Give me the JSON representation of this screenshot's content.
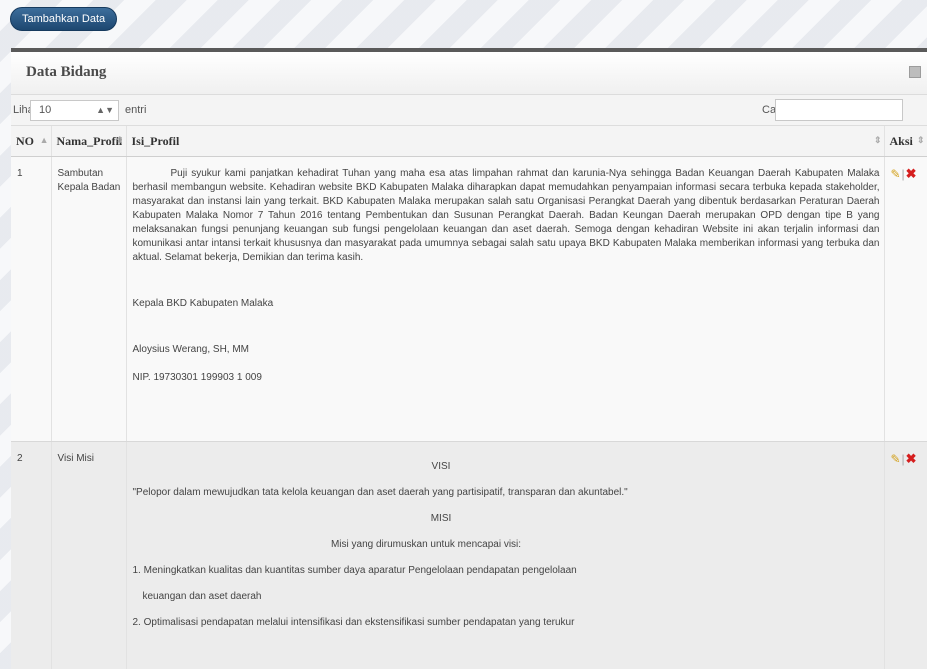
{
  "toolbar": {
    "add_label": "Tambahkan Data"
  },
  "panel": {
    "title": "Data Bidang"
  },
  "controls": {
    "show_label": "Lihat",
    "page_length": "10",
    "entries_label": "entri",
    "search_label": "Cari:",
    "search_value": ""
  },
  "table": {
    "headers": {
      "no": "NO",
      "nama": "Nama_Profil",
      "isi": "Isi_Profil",
      "aksi": "Aksi"
    },
    "rows": [
      {
        "no": "1",
        "nama": "Sambutan Kepala Badan",
        "isi_paragraph": "Puji syukur kami panjatkan kehadirat Tuhan yang maha esa atas limpahan rahmat dan karunia-Nya sehingga Badan Keuangan Daerah Kabupaten Malaka berhasil membangun website. Kehadiran website BKD Kabupaten Malaka diharapkan dapat memudahkan penyampaian informasi secara terbuka kepada stakeholder, masyarakat dan instansi lain yang terkait. BKD Kabupaten Malaka merupakan salah satu Organisasi Perangkat Daerah yang dibentuk berdasarkan Peraturan Daerah Kabupaten Malaka Nomor 7 Tahun 2016 tentang Pembentukan dan Susunan Perangkat Daerah. Badan Keungan Daerah merupakan OPD dengan tipe B yang melaksanakan fungsi penunjang keuangan sub fungsi pengelolaan keuangan dan aset daerah. Semoga dengan kehadiran Website ini akan terjalin informasi dan komunikasi antar intansi terkait khususnya dan masyarakat pada umumnya sebagai salah satu upaya BKD Kabupaten Malaka memberikan informasi yang terbuka dan aktual. Selamat bekerja, Demikian dan terima kasih.",
        "signature_title": "Kepala BKD Kabupaten Malaka",
        "signature_name": "Aloysius Werang, SH, MM",
        "signature_nip": "NIP. 19730301 199903 1 009"
      },
      {
        "no": "2",
        "nama": "Visi Misi",
        "visi_heading": "VISI",
        "visi_text": "\"Pelopor dalam mewujudkan tata kelola keuangan dan aset daerah yang partisipatif, transparan dan akuntabel.\"",
        "misi_heading": "MISI",
        "misi_intro": "Misi yang dirumuskan untuk mencapai visi:",
        "misi_1a": "1. Meningkatkan kualitas dan kuantitas sumber daya aparatur Pengelolaan pendapatan pengelolaan",
        "misi_1b": "keuangan dan aset daerah",
        "misi_2": "2. Optimalisasi pendapatan melalui intensifikasi dan ekstensifikasi sumber pendapatan yang terukur"
      }
    ]
  }
}
